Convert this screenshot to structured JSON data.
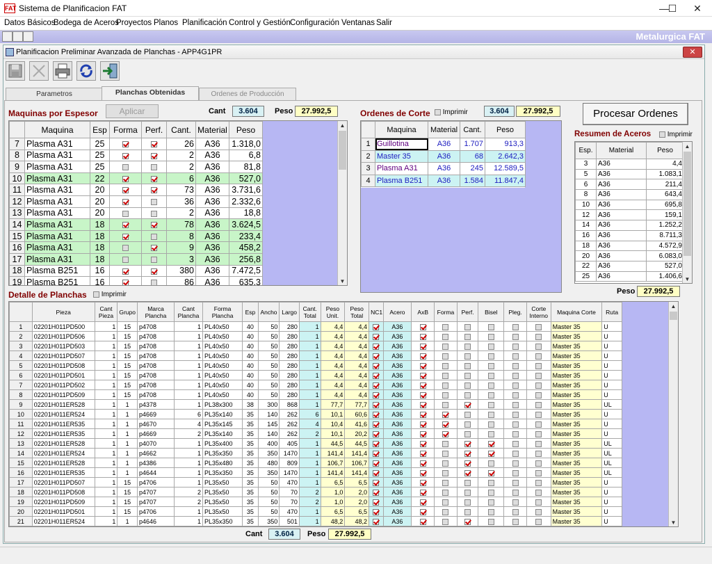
{
  "window": {
    "title": "Sistema de Planificacion FAT",
    "logo": "FAT"
  },
  "menu": [
    "Datos Básicos",
    "Bodega de Aceros",
    "Proyectos",
    "Planos",
    "Planificación",
    "Control y Gestión",
    "Configuración",
    "Ventanas",
    "Salir"
  ],
  "brand": "Metalurgica FAT",
  "dialog": {
    "title": "Planificacion Preliminar Avanzada de Planchas - APP4G1PR"
  },
  "toolbar": [
    "save-icon",
    "cancel-icon",
    "print-icon",
    "refresh-icon",
    "exit-icon"
  ],
  "tabs": [
    "Parametros",
    "Planchas Obtenidas",
    "Ordenes de Producción"
  ],
  "maquinas": {
    "title": "Maquinas por Espesor",
    "aplicar": "Aplicar",
    "cant_label": "Cant",
    "cant": "3.604",
    "peso_label": "Peso",
    "peso": "27.992,5",
    "headers": [
      "Maquina",
      "Esp",
      "Forma",
      "Perf.",
      "Cant.",
      "Material",
      "Peso"
    ],
    "rows": [
      {
        "n": "7",
        "maq": "Plasma A31",
        "esp": "25",
        "forma": true,
        "perf": true,
        "cant": "26",
        "mat": "A36",
        "peso": "1.318,0",
        "g": false
      },
      {
        "n": "8",
        "maq": "Plasma A31",
        "esp": "25",
        "forma": true,
        "perf": true,
        "cant": "2",
        "mat": "A36",
        "peso": "6,8",
        "g": false
      },
      {
        "n": "9",
        "maq": "Plasma A31",
        "esp": "25",
        "forma": false,
        "perf": false,
        "cant": "2",
        "mat": "A36",
        "peso": "81,8",
        "g": false
      },
      {
        "n": "10",
        "maq": "Plasma A31",
        "esp": "22",
        "forma": true,
        "perf": true,
        "cant": "6",
        "mat": "A36",
        "peso": "527,0",
        "g": true
      },
      {
        "n": "11",
        "maq": "Plasma A31",
        "esp": "20",
        "forma": true,
        "perf": true,
        "cant": "73",
        "mat": "A36",
        "peso": "3.731,6",
        "g": false
      },
      {
        "n": "12",
        "maq": "Plasma A31",
        "esp": "20",
        "forma": true,
        "perf": false,
        "cant": "36",
        "mat": "A36",
        "peso": "2.332,6",
        "g": false
      },
      {
        "n": "13",
        "maq": "Plasma A31",
        "esp": "20",
        "forma": false,
        "perf": false,
        "cant": "2",
        "mat": "A36",
        "peso": "18,8",
        "g": false
      },
      {
        "n": "14",
        "maq": "Plasma A31",
        "esp": "18",
        "forma": true,
        "perf": true,
        "cant": "78",
        "mat": "A36",
        "peso": "3.624,5",
        "g": true
      },
      {
        "n": "15",
        "maq": "Plasma A31",
        "esp": "18",
        "forma": true,
        "perf": false,
        "cant": "8",
        "mat": "A36",
        "peso": "233,4",
        "g": true
      },
      {
        "n": "16",
        "maq": "Plasma A31",
        "esp": "18",
        "forma": false,
        "perf": true,
        "cant": "9",
        "mat": "A36",
        "peso": "458,2",
        "g": true
      },
      {
        "n": "17",
        "maq": "Plasma A31",
        "esp": "18",
        "forma": false,
        "perf": false,
        "cant": "3",
        "mat": "A36",
        "peso": "256,8",
        "g": true
      },
      {
        "n": "18",
        "maq": "Plasma B251",
        "esp": "16",
        "forma": true,
        "perf": true,
        "cant": "380",
        "mat": "A36",
        "peso": "7.472,5",
        "g": false
      },
      {
        "n": "19",
        "maq": "Plasma B251",
        "esp": "16",
        "forma": true,
        "perf": false,
        "cant": "86",
        "mat": "A36",
        "peso": "635,3",
        "g": false
      }
    ]
  },
  "ordenes": {
    "title": "Ordenes de Corte",
    "imprimir": "Imprimir",
    "cant": "3.604",
    "peso": "27.992,5",
    "headers": [
      "Maquina",
      "Material",
      "Cant.",
      "Peso"
    ],
    "rows": [
      {
        "n": "1",
        "maq": "Guillotina",
        "mat": "A36",
        "cant": "1.707",
        "peso": "913,3"
      },
      {
        "n": "2",
        "maq": "Master 35",
        "mat": "A36",
        "cant": "68",
        "peso": "2.642,3"
      },
      {
        "n": "3",
        "maq": "Plasma A31",
        "mat": "A36",
        "cant": "245",
        "peso": "12.589,5"
      },
      {
        "n": "4",
        "maq": "Plasma B251",
        "mat": "A36",
        "cant": "1.584",
        "peso": "11.847,4"
      }
    ]
  },
  "procesar": "Procesar Ordenes",
  "resumen": {
    "title": "Resumen de Aceros",
    "imprimir": "Imprimir",
    "peso_label": "Peso",
    "peso": "27.992,5",
    "headers": [
      "Esp.",
      "Material",
      "Peso"
    ],
    "rows": [
      [
        "3",
        "A36",
        "4,4"
      ],
      [
        "5",
        "A36",
        "1.083,1"
      ],
      [
        "6",
        "A36",
        "211,4"
      ],
      [
        "8",
        "A36",
        "643,4"
      ],
      [
        "10",
        "A36",
        "695,8"
      ],
      [
        "12",
        "A36",
        "159,1"
      ],
      [
        "14",
        "A36",
        "1.252,2"
      ],
      [
        "16",
        "A36",
        "8.711,3"
      ],
      [
        "18",
        "A36",
        "4.572,9"
      ],
      [
        "20",
        "A36",
        "6.083,0"
      ],
      [
        "22",
        "A36",
        "527,0"
      ],
      [
        "25",
        "A36",
        "1.406,6"
      ]
    ]
  },
  "detalle": {
    "title": "Detalle de Planchas",
    "imprimir": "Imprimir",
    "headers": [
      "Pieza",
      "Cant Pieza",
      "Grupo",
      "Marca Plancha",
      "Cant Plancha",
      "Forma Plancha",
      "Esp",
      "Ancho",
      "Largo",
      "Cant. Total",
      "Peso Unit.",
      "Peso Total",
      "NC1",
      "Acero",
      "AxB",
      "Forma",
      "Perf.",
      "Bisel",
      "Pleg.",
      "Corte Interno",
      "Maquina Corte",
      "Ruta"
    ],
    "rows": [
      [
        "1",
        "02201H011PD500",
        "1",
        "15",
        "p4708",
        "1",
        "PL40x50",
        "40",
        "50",
        "280",
        "1",
        "4,4",
        "4,4",
        1,
        "A36",
        1,
        0,
        0,
        0,
        0,
        0,
        "Master 35",
        "U"
      ],
      [
        "2",
        "02201H011PD506",
        "1",
        "15",
        "p4708",
        "1",
        "PL40x50",
        "40",
        "50",
        "280",
        "1",
        "4,4",
        "4,4",
        1,
        "A36",
        1,
        0,
        0,
        0,
        0,
        0,
        "Master 35",
        "U"
      ],
      [
        "3",
        "02201H011PD503",
        "1",
        "15",
        "p4708",
        "1",
        "PL40x50",
        "40",
        "50",
        "280",
        "1",
        "4,4",
        "4,4",
        1,
        "A36",
        1,
        0,
        0,
        0,
        0,
        0,
        "Master 35",
        "U"
      ],
      [
        "4",
        "02201H011PD507",
        "1",
        "15",
        "p4708",
        "1",
        "PL40x50",
        "40",
        "50",
        "280",
        "1",
        "4,4",
        "4,4",
        1,
        "A36",
        1,
        0,
        0,
        0,
        0,
        0,
        "Master 35",
        "U"
      ],
      [
        "5",
        "02201H011PD508",
        "1",
        "15",
        "p4708",
        "1",
        "PL40x50",
        "40",
        "50",
        "280",
        "1",
        "4,4",
        "4,4",
        1,
        "A36",
        1,
        0,
        0,
        0,
        0,
        0,
        "Master 35",
        "U"
      ],
      [
        "6",
        "02201H011PD501",
        "1",
        "15",
        "p4708",
        "1",
        "PL40x50",
        "40",
        "50",
        "280",
        "1",
        "4,4",
        "4,4",
        1,
        "A36",
        1,
        0,
        0,
        0,
        0,
        0,
        "Master 35",
        "U"
      ],
      [
        "7",
        "02201H011PD502",
        "1",
        "15",
        "p4708",
        "1",
        "PL40x50",
        "40",
        "50",
        "280",
        "1",
        "4,4",
        "4,4",
        1,
        "A36",
        1,
        0,
        0,
        0,
        0,
        0,
        "Master 35",
        "U"
      ],
      [
        "8",
        "02201H011PD509",
        "1",
        "15",
        "p4708",
        "1",
        "PL40x50",
        "40",
        "50",
        "280",
        "1",
        "4,4",
        "4,4",
        1,
        "A36",
        1,
        0,
        0,
        0,
        0,
        0,
        "Master 35",
        "U"
      ],
      [
        "9",
        "02201H011ER528",
        "1",
        "1",
        "p4378",
        "1",
        "PL38x300",
        "38",
        "300",
        "868",
        "1",
        "77,7",
        "77,7",
        1,
        "A36",
        1,
        0,
        1,
        0,
        0,
        0,
        "Master 35",
        "UL"
      ],
      [
        "10",
        "02201H011ER524",
        "1",
        "1",
        "p4669",
        "6",
        "PL35x140",
        "35",
        "140",
        "262",
        "6",
        "10,1",
        "60,6",
        1,
        "A36",
        1,
        1,
        0,
        0,
        0,
        0,
        "Master 35",
        "U"
      ],
      [
        "11",
        "02201H011ER535",
        "1",
        "1",
        "p4670",
        "4",
        "PL35x145",
        "35",
        "145",
        "262",
        "4",
        "10,4",
        "41,6",
        1,
        "A36",
        1,
        1,
        0,
        0,
        0,
        0,
        "Master 35",
        "U"
      ],
      [
        "12",
        "02201H011ER535",
        "1",
        "1",
        "p4669",
        "2",
        "PL35x140",
        "35",
        "140",
        "262",
        "2",
        "10,1",
        "20,2",
        1,
        "A36",
        1,
        1,
        0,
        0,
        0,
        0,
        "Master 35",
        "U"
      ],
      [
        "13",
        "02201H011ER528",
        "1",
        "1",
        "p4070",
        "1",
        "PL35x400",
        "35",
        "400",
        "405",
        "1",
        "44,5",
        "44,5",
        1,
        "A36",
        1,
        0,
        1,
        1,
        0,
        0,
        "Master 35",
        "UL"
      ],
      [
        "14",
        "02201H011ER524",
        "1",
        "1",
        "p4662",
        "1",
        "PL35x350",
        "35",
        "350",
        "1470",
        "1",
        "141,4",
        "141,4",
        1,
        "A36",
        1,
        0,
        1,
        1,
        0,
        0,
        "Master 35",
        "UL"
      ],
      [
        "15",
        "02201H011ER528",
        "1",
        "1",
        "p4386",
        "1",
        "PL35x480",
        "35",
        "480",
        "809",
        "1",
        "106,7",
        "106,7",
        1,
        "A36",
        1,
        0,
        1,
        0,
        0,
        0,
        "Master 35",
        "UL"
      ],
      [
        "16",
        "02201H011ER535",
        "1",
        "1",
        "p4644",
        "1",
        "PL35x350",
        "35",
        "350",
        "1470",
        "1",
        "141,4",
        "141,4",
        1,
        "A36",
        1,
        0,
        1,
        1,
        0,
        0,
        "Master 35",
        "UL"
      ],
      [
        "17",
        "02201H011PD507",
        "1",
        "15",
        "p4706",
        "1",
        "PL35x50",
        "35",
        "50",
        "470",
        "1",
        "6,5",
        "6,5",
        1,
        "A36",
        1,
        0,
        0,
        0,
        0,
        0,
        "Master 35",
        "U"
      ],
      [
        "18",
        "02201H011PD508",
        "1",
        "15",
        "p4707",
        "2",
        "PL35x50",
        "35",
        "50",
        "70",
        "2",
        "1,0",
        "2,0",
        1,
        "A36",
        1,
        0,
        0,
        0,
        0,
        0,
        "Master 35",
        "U"
      ],
      [
        "19",
        "02201H011PD509",
        "1",
        "15",
        "p4707",
        "2",
        "PL35x50",
        "35",
        "50",
        "70",
        "2",
        "1,0",
        "2,0",
        1,
        "A36",
        1,
        0,
        0,
        0,
        0,
        0,
        "Master 35",
        "U"
      ],
      [
        "20",
        "02201H011PD501",
        "1",
        "15",
        "p4706",
        "1",
        "PL35x50",
        "35",
        "50",
        "470",
        "1",
        "6,5",
        "6,5",
        1,
        "A36",
        1,
        0,
        0,
        0,
        0,
        0,
        "Master 35",
        "U"
      ],
      [
        "21",
        "02201H011ER524",
        "1",
        "1",
        "p4646",
        "1",
        "PL35x350",
        "35",
        "350",
        "501",
        "1",
        "48,2",
        "48,2",
        1,
        "A36",
        1,
        0,
        1,
        0,
        0,
        0,
        "Master 35",
        "U"
      ]
    ],
    "cant_label": "Cant",
    "cant": "3.604",
    "peso_label": "Peso",
    "peso": "27.992,5"
  }
}
